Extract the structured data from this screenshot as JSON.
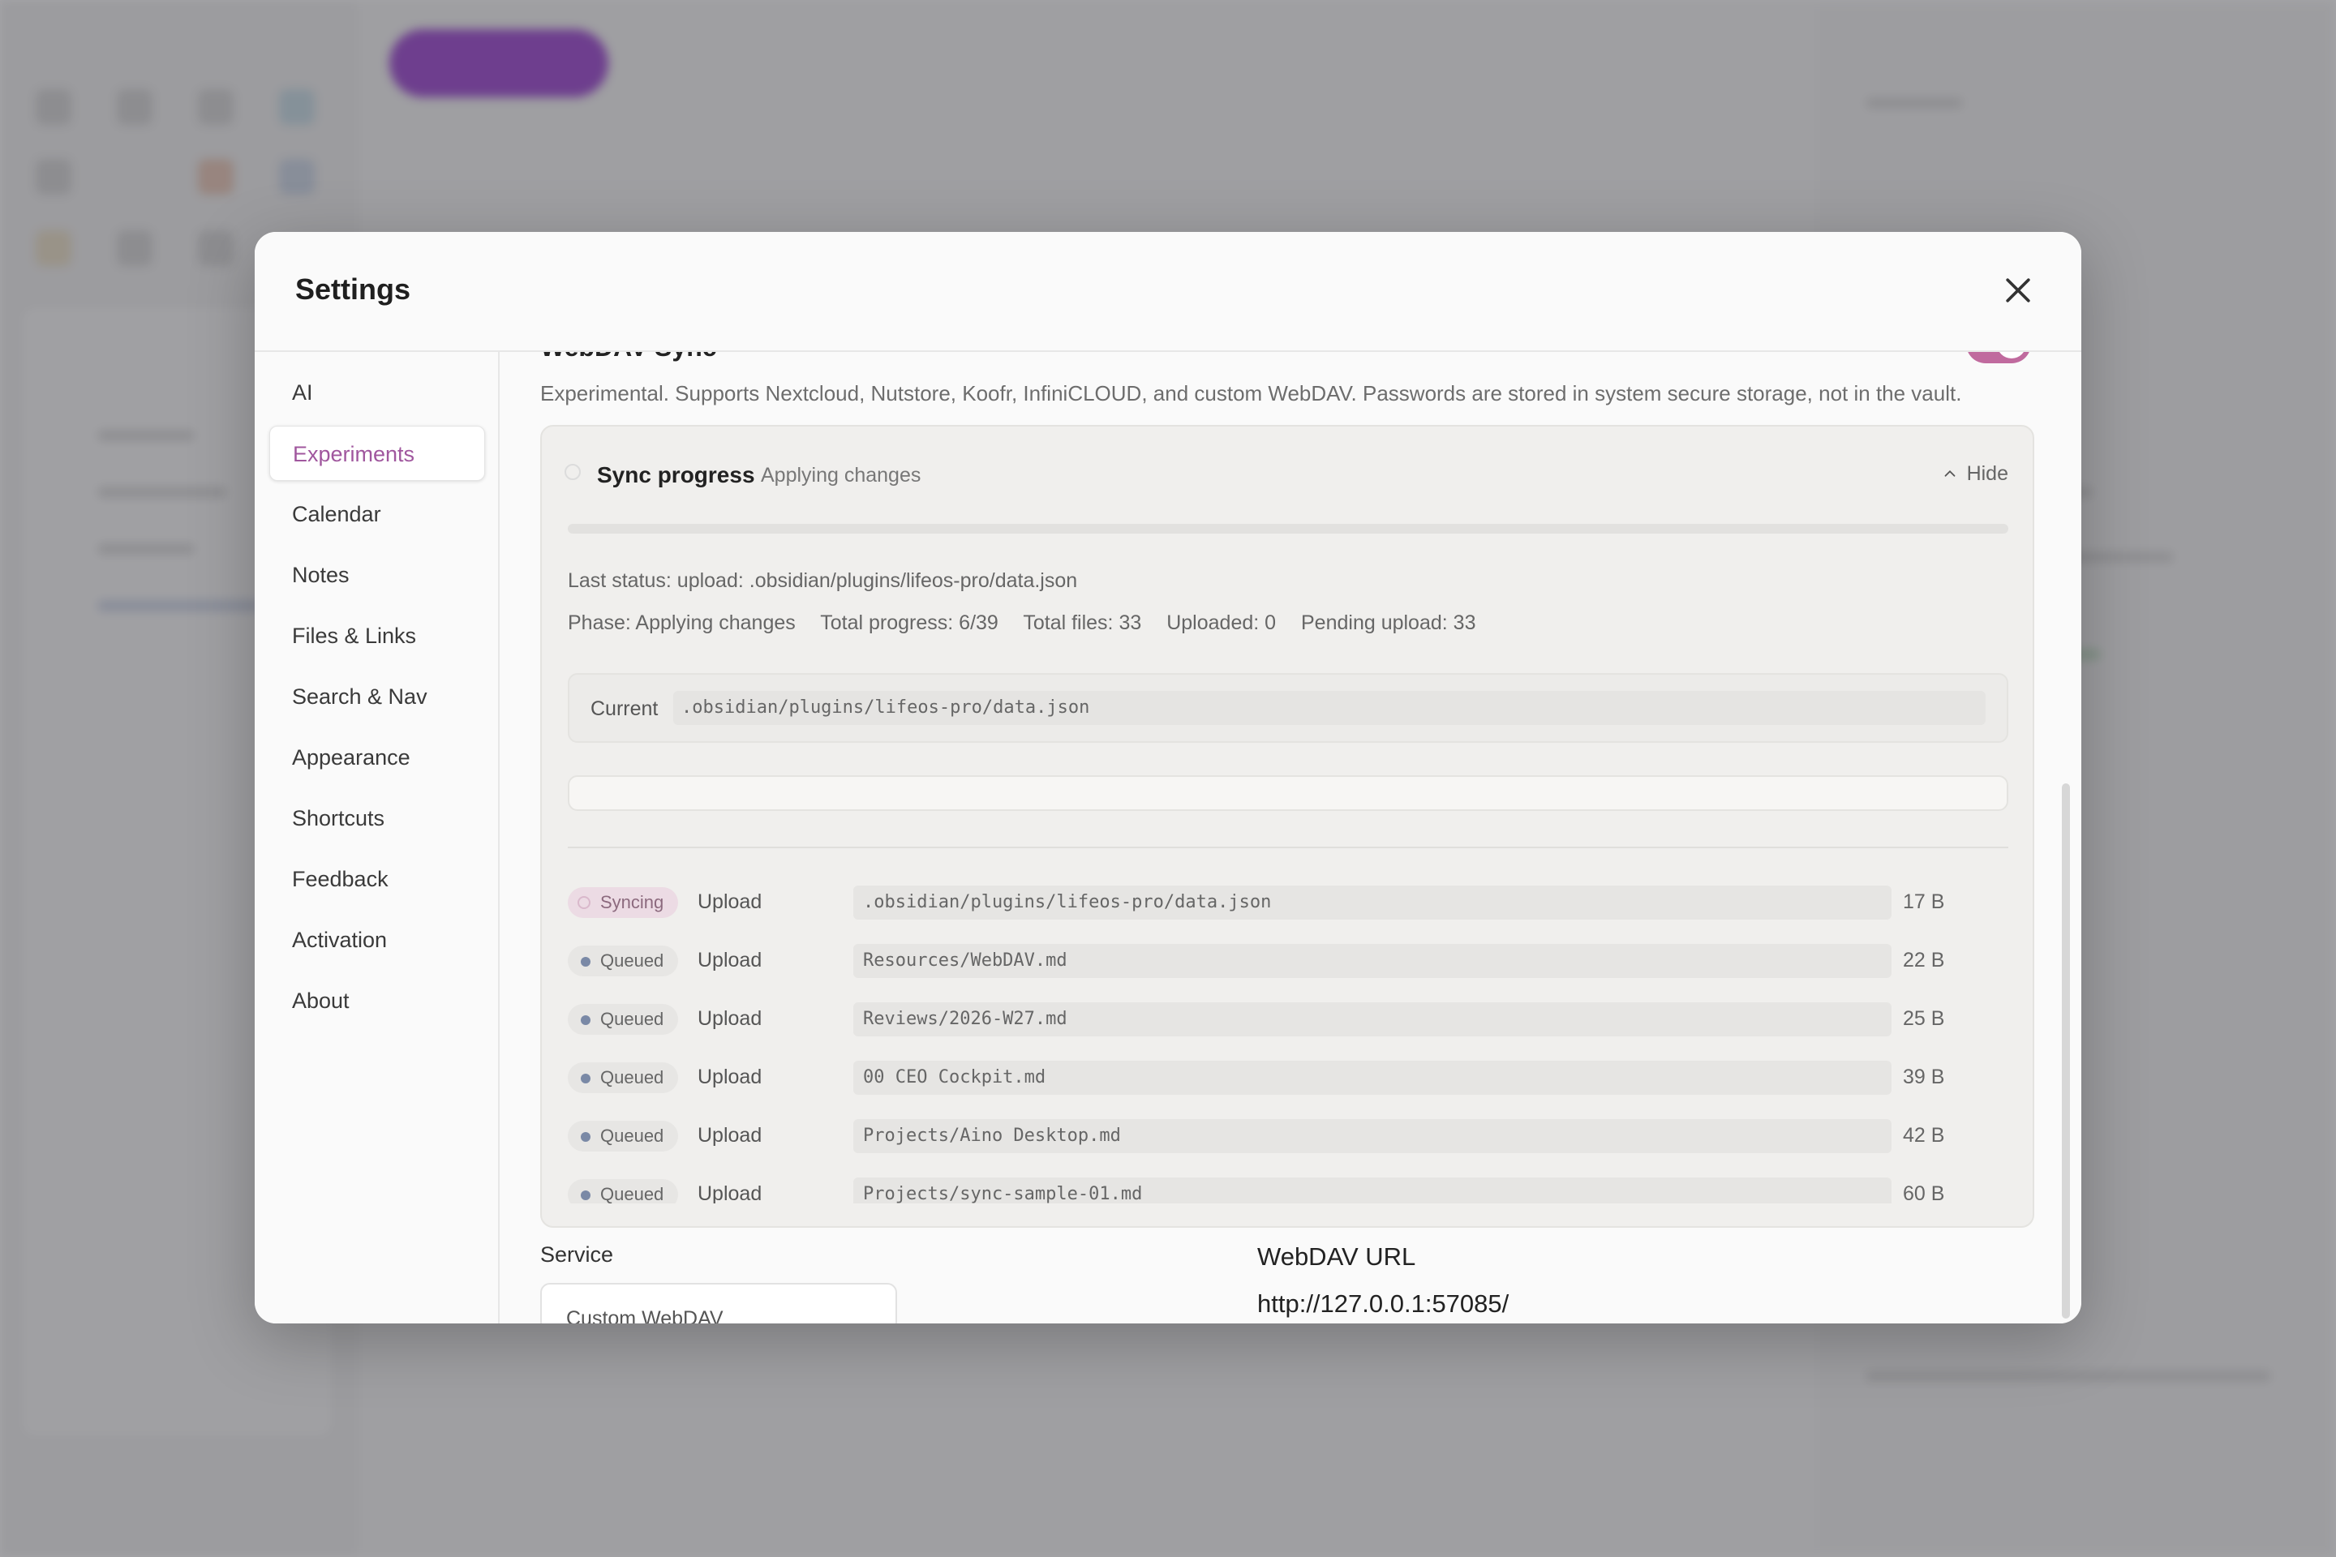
{
  "modal": {
    "title": "Settings"
  },
  "sidebar": {
    "items": [
      {
        "label": "AI"
      },
      {
        "label": "Experiments"
      },
      {
        "label": "Calendar"
      },
      {
        "label": "Notes"
      },
      {
        "label": "Files & Links"
      },
      {
        "label": "Search & Nav"
      },
      {
        "label": "Appearance"
      },
      {
        "label": "Shortcuts"
      },
      {
        "label": "Feedback"
      },
      {
        "label": "Activation"
      },
      {
        "label": "About"
      }
    ],
    "active": "Experiments"
  },
  "section": {
    "title": "WebDAV Sync",
    "description": "Experimental. Supports Nextcloud, Nutstore, Koofr, InfiniCLOUD, and custom WebDAV. Passwords are stored in system secure storage, not in the vault.",
    "enabled": true
  },
  "sync_progress": {
    "title": "Sync progress",
    "subtitle": "Applying changes",
    "hide_label": "Hide",
    "progress_fraction": 0,
    "last_status": "Last status: upload: .obsidian/plugins/lifeos-pro/data.json",
    "stats": {
      "phase": "Phase: Applying changes",
      "total_progress": "Total progress: 6/39",
      "total_files": "Total files: 33",
      "uploaded": "Uploaded: 0",
      "pending_upload": "Pending upload: 33"
    },
    "current_label": "Current",
    "current_path": ".obsidian/plugins/lifeos-pro/data.json",
    "rows": [
      {
        "status": "Syncing",
        "op": "Upload",
        "path": ".obsidian/plugins/lifeos-pro/data.json",
        "size": "17 B"
      },
      {
        "status": "Queued",
        "op": "Upload",
        "path": "Resources/WebDAV.md",
        "size": "22 B"
      },
      {
        "status": "Queued",
        "op": "Upload",
        "path": "Reviews/2026-W27.md",
        "size": "25 B"
      },
      {
        "status": "Queued",
        "op": "Upload",
        "path": "00 CEO Cockpit.md",
        "size": "39 B"
      },
      {
        "status": "Queued",
        "op": "Upload",
        "path": "Projects/Aino Desktop.md",
        "size": "42 B"
      },
      {
        "status": "Queued",
        "op": "Upload",
        "path": "Projects/sync-sample-01.md",
        "size": "60 B"
      }
    ]
  },
  "service": {
    "label": "Service",
    "value": "Custom WebDAV"
  },
  "webdav": {
    "url_label": "WebDAV URL",
    "url_value": "http://127.0.0.1:57085/"
  },
  "colors": {
    "accent": "#a0579e",
    "toggle": "#c06a9e",
    "queued_dot": "#7a89a6"
  }
}
